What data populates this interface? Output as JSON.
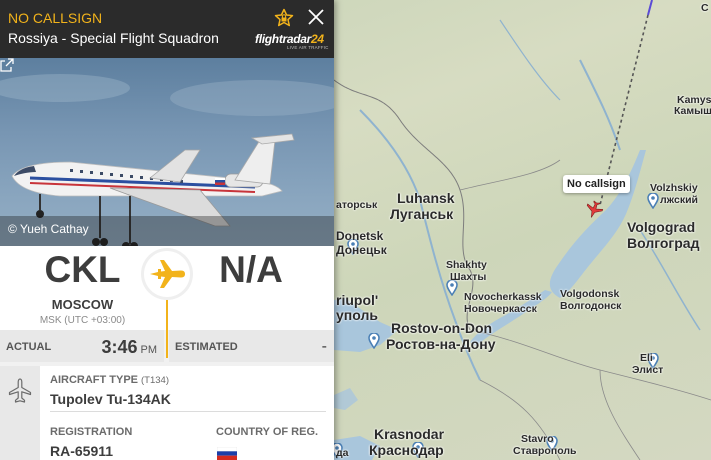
{
  "header": {
    "callsign": "NO CALLSIGN",
    "airline": "Rossiya - Special Flight Squadron",
    "logo_text": "flightradar",
    "logo_number": "24",
    "logo_subtitle": "LIVE AIR TRAFFIC",
    "accent_color": "#f2b31b"
  },
  "photo": {
    "credit": "© Yueh Cathay"
  },
  "route": {
    "origin": {
      "code": "CKL",
      "city": "MOSCOW",
      "timezone": "MSK (UTC +03:00)"
    },
    "destination": {
      "code": "N/A"
    }
  },
  "times": {
    "actual_label": "ACTUAL",
    "actual_time": "3:46",
    "actual_ampm": "PM",
    "estimated_label": "ESTIMATED",
    "estimated_value": "-"
  },
  "aircraft": {
    "type_label": "AIRCRAFT TYPE",
    "type_code": "(T134)",
    "type_name": "Tupolev Tu-134AK",
    "registration_label": "REGISTRATION",
    "registration": "RA-65911",
    "country_label": "COUNTRY OF REG.",
    "country_flag": "russia-flag"
  },
  "map": {
    "flight_tag": "No callsign",
    "labels": [
      {
        "id": "luhansk",
        "text": "Luhansk"
      },
      {
        "id": "luhansk_cyr",
        "text": "Луганськ"
      },
      {
        "id": "donetsk",
        "text": "Donetsk"
      },
      {
        "id": "donetsk_cyr",
        "text": "Донецьк"
      },
      {
        "id": "matorsk",
        "text": "аторськ"
      },
      {
        "id": "shakhty",
        "text": "Shakhty"
      },
      {
        "id": "shakhty_cyr",
        "text": "Шахты"
      },
      {
        "id": "novocherkassk",
        "text": "Novocherkassk"
      },
      {
        "id": "novocherkassk_cyr",
        "text": "Новочеркасск"
      },
      {
        "id": "mariupol",
        "text": "riupol'"
      },
      {
        "id": "mariupol_cyr",
        "text": "уполь"
      },
      {
        "id": "rostov",
        "text": "Rostov-on-Don"
      },
      {
        "id": "rostov_cyr",
        "text": "Ростов-на-Дону"
      },
      {
        "id": "volgodonsk",
        "text": "Volgodonsk"
      },
      {
        "id": "volgodonsk_cyr",
        "text": "Волгодонск"
      },
      {
        "id": "volzhskiy",
        "text": "Volzhskiy"
      },
      {
        "id": "volzhskiy_cyr",
        "text": "лжский"
      },
      {
        "id": "volgograd",
        "text": "Volgograd"
      },
      {
        "id": "volgograd_cyr",
        "text": "Волгоград"
      },
      {
        "id": "kamysh",
        "text": "Kamys"
      },
      {
        "id": "kamysh_cyr",
        "text": "Камыш"
      },
      {
        "id": "elista",
        "text": "Eli"
      },
      {
        "id": "elista_cyr",
        "text": "Элист"
      },
      {
        "id": "krasnodar",
        "text": "Krasnodar"
      },
      {
        "id": "krasnodar_cyr",
        "text": "Краснодар"
      },
      {
        "id": "stavropol",
        "text": "Stavro"
      },
      {
        "id": "stavropol_cyr",
        "text": "Ставрополь"
      },
      {
        "id": "top_right",
        "text": "C"
      },
      {
        "id": "bottom_small",
        "text": "да"
      }
    ]
  }
}
